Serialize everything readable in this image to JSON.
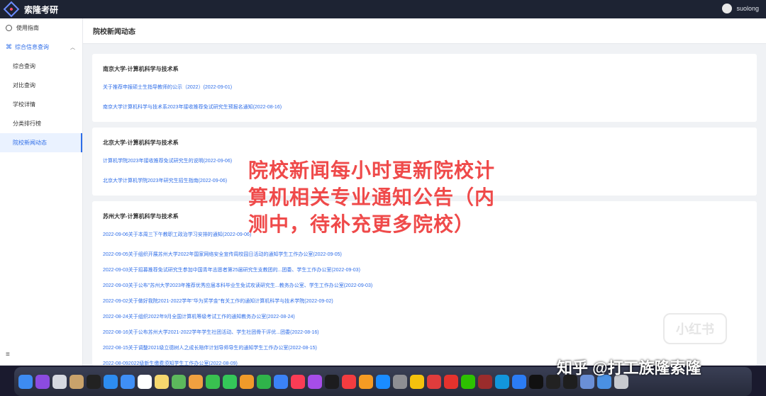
{
  "topbar": {
    "title": "索隆考研",
    "username": "suolong"
  },
  "sidebar": {
    "guide": "使用指南",
    "group": "综合信息查询",
    "items": [
      {
        "label": "综合查询",
        "active": false
      },
      {
        "label": "对比查询",
        "active": false
      },
      {
        "label": "学校详情",
        "active": false
      },
      {
        "label": "分类排行榜",
        "active": false
      },
      {
        "label": "院校新闻动态",
        "active": true
      }
    ],
    "collapse_icon": "≡"
  },
  "page": {
    "title": "院校新闻动态"
  },
  "cards": [
    {
      "title": "南京大学-计算机科学与技术系",
      "links": [
        "关于推荐申报硕士生指导教师的公示（2022）(2022-09-01)",
        "南京大学计算机科学与技术系2023年接收推荐免试研究生预报名通知(2022-08-16)"
      ]
    },
    {
      "title": "北京大学-计算机科学与技术系",
      "links": [
        "计算机学院2023年接收推荐免试研究生的说明(2022-09-06)",
        "北京大学计算机学院2023年研究生招生指南(2022-09-06)"
      ]
    },
    {
      "title": "苏州大学-计算机科学与技术系",
      "links": [
        "2022-09-06关于本周三下午教职工政治学习安排的通知(2022-09-06)",
        "2022-09-05关于组织开展苏州大学2022年国家网络安全宣传周校园日活动的通知学生工作办公室(2022-09-05)",
        "2022-09-03关于招募推荐免试研究生参加中国青年志愿者第25届研究生支教团的...团委、学生工作办公室(2022-09-03)",
        "2022-09-03关于公布\"苏州大学2023年推荐优秀应届本科毕业生免试攻读研究生...教务办公室、学生工作办公室(2022-09-03)",
        "2022-09-02关于做好我院2021-2022学年\"华为奖学金\"有关工作的通知计算机科学与技术学院(2022-09-02)",
        "2022-08-24关于组织2022年9月全国计算机等级考试工作的通知教务办公室(2022-08-24)",
        "2022-08-16关于公布苏州大学2021-2022学年学生社团活动、学生社团骨干评优...团委(2022-08-16)",
        "2022-08-15关于调整2021级立德树人之成长陪伴计划导师导生的通知学生工作办公室(2022-08-15)",
        "2022-08-092022级新生缴费须知学生工作办公室(2022-08-09)"
      ]
    }
  ],
  "overlay_text": "院校新闻每小时更新院校计算机相关专业通知公告（内测中，待补充更多院校）",
  "watermarks": {
    "xiaohongshu": "小红书",
    "zhihu": "知乎 @打工族隆索隆"
  },
  "dock": {
    "icons": [
      {
        "name": "finder-icon",
        "color": "#3d8bf2"
      },
      {
        "name": "siri-icon",
        "color": "#8c4be0"
      },
      {
        "name": "launchpad-icon",
        "color": "#d6d9e0"
      },
      {
        "name": "folder-icon",
        "color": "#c9a26b"
      },
      {
        "name": "terminal-icon",
        "color": "#222222"
      },
      {
        "name": "safari-icon",
        "color": "#2d8cf0"
      },
      {
        "name": "mail-icon",
        "color": "#3f8ff7"
      },
      {
        "name": "calendar-icon",
        "color": "#ffffff"
      },
      {
        "name": "notes-icon",
        "color": "#f5d76e"
      },
      {
        "name": "maps-icon",
        "color": "#5cb85c"
      },
      {
        "name": "photos-icon",
        "color": "#f0a040"
      },
      {
        "name": "messages-icon",
        "color": "#39c150"
      },
      {
        "name": "facetime-icon",
        "color": "#34c759"
      },
      {
        "name": "pages-icon",
        "color": "#f09a2a"
      },
      {
        "name": "numbers-icon",
        "color": "#2fb34a"
      },
      {
        "name": "keynote-icon",
        "color": "#3b82f6"
      },
      {
        "name": "music-icon",
        "color": "#fa3c55"
      },
      {
        "name": "podcasts-icon",
        "color": "#a64de8"
      },
      {
        "name": "appletv-icon",
        "color": "#1c1c1e"
      },
      {
        "name": "news-icon",
        "color": "#f23c40"
      },
      {
        "name": "books-icon",
        "color": "#f59b23"
      },
      {
        "name": "appstore-icon",
        "color": "#1a8cff"
      },
      {
        "name": "settings-icon",
        "color": "#8e8e93"
      },
      {
        "name": "chrome-icon",
        "color": "#f4c20d"
      },
      {
        "name": "parallels-icon",
        "color": "#e03c3c"
      },
      {
        "name": "wps-icon",
        "color": "#e5322d"
      },
      {
        "name": "wechat-icon",
        "color": "#2dc100"
      },
      {
        "name": "dictionary-icon",
        "color": "#9b2c2c"
      },
      {
        "name": "qq-icon",
        "color": "#1296db"
      },
      {
        "name": "baidu-netdisk-icon",
        "color": "#2b7cf5"
      },
      {
        "name": "webstorm-icon",
        "color": "#111111"
      },
      {
        "name": "intellij-icon",
        "color": "#222222"
      },
      {
        "name": "datagrip-icon",
        "color": "#1e1e1e"
      },
      {
        "name": "preview-icon",
        "color": "#6a8fd6"
      },
      {
        "name": "downloads-icon",
        "color": "#4a90e2"
      },
      {
        "name": "trash-icon",
        "color": "#c7c9cf"
      }
    ]
  }
}
